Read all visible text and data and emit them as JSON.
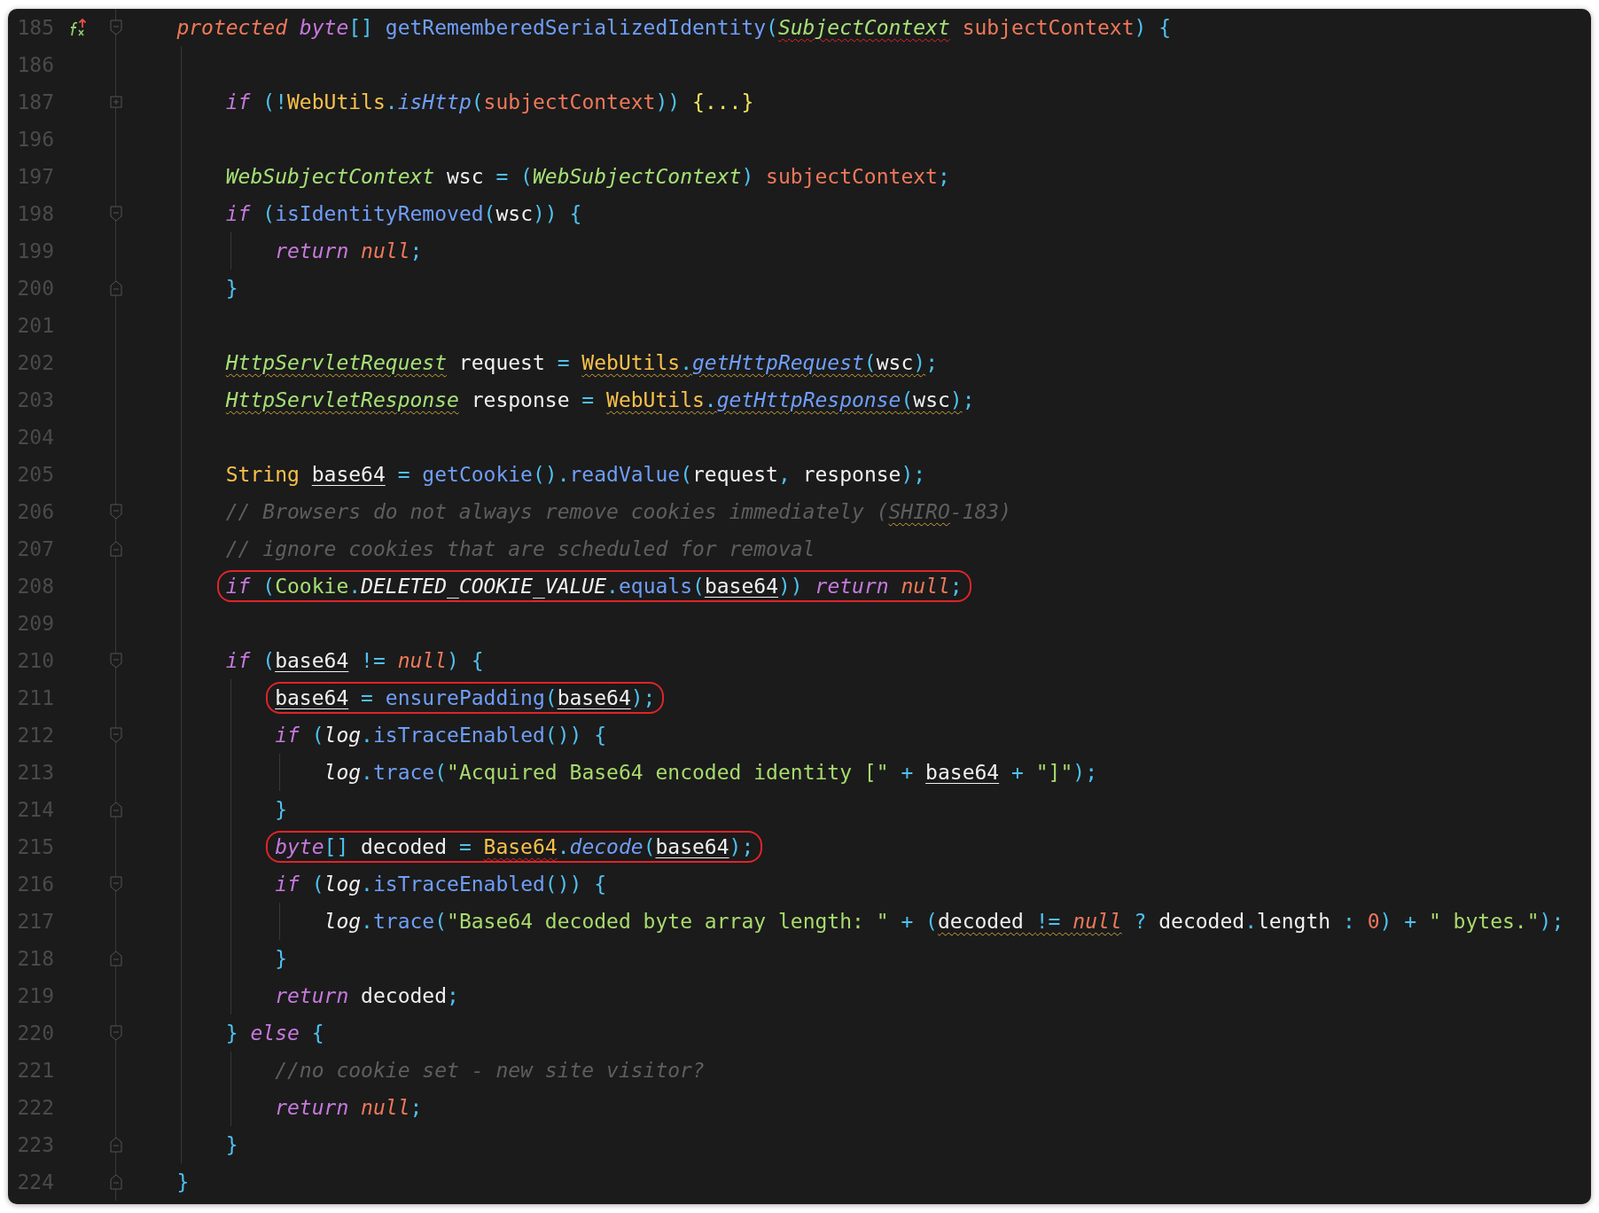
{
  "lines": [
    {
      "number": "185",
      "fold": {
        "kind": "start"
      },
      "marker": {
        "kind": "recursion"
      },
      "tokens": [
        {
          "text": "protected ",
          "kind": "modifier"
        },
        {
          "text": "byte",
          "kind": "keyword"
        },
        {
          "text": "[] ",
          "kind": "punct"
        },
        {
          "text": "getRememberedSerializedIdentity",
          "kind": "method"
        },
        {
          "text": "(",
          "kind": "punct"
        },
        {
          "text": "SubjectContext",
          "kind": "type",
          "deco": {
            "kind": "error"
          }
        },
        {
          "text": " subjectContext",
          "kind": "param"
        },
        {
          "text": ") {",
          "kind": "punct"
        }
      ],
      "children": [
        {
          "number": "186"
        },
        {
          "number": "187",
          "fold": {
            "kind": "collapsed"
          },
          "tokens": [
            {
              "text": "if ",
              "kind": "keyword"
            },
            {
              "text": "(!",
              "kind": "punct"
            },
            {
              "text": "WebUtils",
              "kind": "class"
            },
            {
              "text": ".",
              "kind": "punct"
            },
            {
              "text": "isHttp",
              "kind": "static-method"
            },
            {
              "text": "(",
              "kind": "punct"
            },
            {
              "text": "subjectContext",
              "kind": "param"
            },
            {
              "text": ")) ",
              "kind": "punct"
            },
            {
              "text": "{...}",
              "kind": "folded"
            }
          ]
        },
        {
          "number": "196"
        },
        {
          "number": "197",
          "tokens": [
            {
              "text": "WebSubjectContext",
              "kind": "type"
            },
            {
              "text": " wsc ",
              "kind": "plain"
            },
            {
              "text": "= (",
              "kind": "punct"
            },
            {
              "text": "WebSubjectContext",
              "kind": "type"
            },
            {
              "text": ") ",
              "kind": "punct"
            },
            {
              "text": "subjectContext",
              "kind": "param"
            },
            {
              "text": ";",
              "kind": "punct"
            }
          ]
        },
        {
          "number": "198",
          "fold": {
            "kind": "start"
          },
          "tokens": [
            {
              "text": "if ",
              "kind": "keyword"
            },
            {
              "text": "(",
              "kind": "punct"
            },
            {
              "text": "isIdentityRemoved",
              "kind": "method"
            },
            {
              "text": "(",
              "kind": "punct"
            },
            {
              "text": "wsc",
              "kind": "plain"
            },
            {
              "text": ")) {",
              "kind": "punct"
            }
          ],
          "children": [
            {
              "number": "199",
              "tokens": [
                {
                  "text": "return ",
                  "kind": "keyword"
                },
                {
                  "text": "null",
                  "kind": "null"
                },
                {
                  "text": ";",
                  "kind": "punct"
                }
              ]
            }
          ]
        },
        {
          "number": "200",
          "fold": {
            "kind": "end"
          },
          "tokens": [
            {
              "text": "}",
              "kind": "punct"
            }
          ]
        },
        {
          "number": "201"
        },
        {
          "number": "202",
          "tokens": [
            {
              "text": "HttpServletRequest",
              "kind": "type",
              "deco": {
                "kind": "warning"
              }
            },
            {
              "text": " request ",
              "kind": "plain"
            },
            {
              "text": "= ",
              "kind": "punct"
            },
            {
              "text": "WebUtils",
              "kind": "class",
              "deco": {
                "kind": "warning"
              }
            },
            {
              "text": ".",
              "kind": "punct",
              "deco": {
                "kind": "warning"
              }
            },
            {
              "text": "getHttpRequest",
              "kind": "static-method",
              "deco": {
                "kind": "warning"
              }
            },
            {
              "text": "(",
              "kind": "punct",
              "deco": {
                "kind": "warning"
              }
            },
            {
              "text": "wsc",
              "kind": "plain",
              "deco": {
                "kind": "warning"
              }
            },
            {
              "text": ")",
              "kind": "punct",
              "deco": {
                "kind": "warning"
              }
            },
            {
              "text": ";",
              "kind": "punct"
            }
          ]
        },
        {
          "number": "203",
          "tokens": [
            {
              "text": "HttpServletResponse",
              "kind": "type",
              "deco": {
                "kind": "warning"
              }
            },
            {
              "text": " response ",
              "kind": "plain"
            },
            {
              "text": "= ",
              "kind": "punct"
            },
            {
              "text": "WebUtils",
              "kind": "class",
              "deco": {
                "kind": "warning"
              }
            },
            {
              "text": ".",
              "kind": "punct",
              "deco": {
                "kind": "warning"
              }
            },
            {
              "text": "getHttpResponse",
              "kind": "static-method",
              "deco": {
                "kind": "warning"
              }
            },
            {
              "text": "(",
              "kind": "punct",
              "deco": {
                "kind": "warning"
              }
            },
            {
              "text": "wsc",
              "kind": "plain",
              "deco": {
                "kind": "warning"
              }
            },
            {
              "text": ")",
              "kind": "punct",
              "deco": {
                "kind": "warning"
              }
            },
            {
              "text": ";",
              "kind": "punct"
            }
          ]
        },
        {
          "number": "204"
        },
        {
          "number": "205",
          "tokens": [
            {
              "text": "String ",
              "kind": "class"
            },
            {
              "text": "base64",
              "kind": "plain",
              "deco": {
                "kind": "underline"
              }
            },
            {
              "text": " = ",
              "kind": "punct"
            },
            {
              "text": "getCookie",
              "kind": "method"
            },
            {
              "text": "().",
              "kind": "punct"
            },
            {
              "text": "readValue",
              "kind": "method"
            },
            {
              "text": "(",
              "kind": "punct"
            },
            {
              "text": "request",
              "kind": "plain"
            },
            {
              "text": ", ",
              "kind": "punct"
            },
            {
              "text": "response",
              "kind": "plain"
            },
            {
              "text": ");",
              "kind": "punct"
            }
          ]
        },
        {
          "number": "206",
          "fold": {
            "kind": "start"
          },
          "tokens": [
            {
              "text": "// Browsers do not always remove cookies immediately (",
              "kind": "comment"
            },
            {
              "text": "SHIRO",
              "kind": "comment",
              "deco": {
                "kind": "warning"
              }
            },
            {
              "text": "-183)",
              "kind": "comment"
            }
          ]
        },
        {
          "number": "207",
          "fold": {
            "kind": "end"
          },
          "tokens": [
            {
              "text": "// ignore cookies that are scheduled for removal",
              "kind": "comment"
            }
          ]
        },
        {
          "number": "208",
          "circled": true,
          "tokens": [
            {
              "text": "if ",
              "kind": "keyword"
            },
            {
              "text": "(",
              "kind": "punct"
            },
            {
              "text": "Cookie",
              "kind": "type-plain"
            },
            {
              "text": ".",
              "kind": "punct"
            },
            {
              "text": "DELETED_COOKIE_VALUE",
              "kind": "field"
            },
            {
              "text": ".",
              "kind": "punct"
            },
            {
              "text": "equals",
              "kind": "method"
            },
            {
              "text": "(",
              "kind": "punct"
            },
            {
              "text": "base64",
              "kind": "plain",
              "deco": {
                "kind": "underline"
              }
            },
            {
              "text": ")) ",
              "kind": "punct"
            },
            {
              "text": "return ",
              "kind": "keyword"
            },
            {
              "text": "null",
              "kind": "null"
            },
            {
              "text": ";",
              "kind": "punct"
            }
          ]
        },
        {
          "number": "209"
        },
        {
          "number": "210",
          "fold": {
            "kind": "start"
          },
          "tokens": [
            {
              "text": "if ",
              "kind": "keyword"
            },
            {
              "text": "(",
              "kind": "punct"
            },
            {
              "text": "base64",
              "kind": "plain",
              "deco": {
                "kind": "underline"
              }
            },
            {
              "text": " != ",
              "kind": "punct"
            },
            {
              "text": "null",
              "kind": "null"
            },
            {
              "text": ") {",
              "kind": "punct"
            }
          ],
          "children": [
            {
              "number": "211",
              "circled": true,
              "tokens": [
                {
                  "text": "base64",
                  "kind": "plain",
                  "deco": {
                    "kind": "underline"
                  }
                },
                {
                  "text": " = ",
                  "kind": "punct"
                },
                {
                  "text": "ensurePadding",
                  "kind": "method"
                },
                {
                  "text": "(",
                  "kind": "punct"
                },
                {
                  "text": "base64",
                  "kind": "plain",
                  "deco": {
                    "kind": "underline"
                  }
                },
                {
                  "text": ");",
                  "kind": "punct"
                }
              ]
            },
            {
              "number": "212",
              "fold": {
                "kind": "start"
              },
              "tokens": [
                {
                  "text": "if ",
                  "kind": "keyword"
                },
                {
                  "text": "(",
                  "kind": "punct"
                },
                {
                  "text": "log",
                  "kind": "field"
                },
                {
                  "text": ".",
                  "kind": "punct"
                },
                {
                  "text": "isTraceEnabled",
                  "kind": "method"
                },
                {
                  "text": "()) {",
                  "kind": "punct"
                }
              ],
              "children": [
                {
                  "number": "213",
                  "tokens": [
                    {
                      "text": "log",
                      "kind": "field"
                    },
                    {
                      "text": ".",
                      "kind": "punct"
                    },
                    {
                      "text": "trace",
                      "kind": "method"
                    },
                    {
                      "text": "(",
                      "kind": "punct"
                    },
                    {
                      "text": "\"Acquired Base64 encoded identity [\"",
                      "kind": "string"
                    },
                    {
                      "text": " + ",
                      "kind": "punct"
                    },
                    {
                      "text": "base64",
                      "kind": "plain",
                      "deco": {
                        "kind": "underline"
                      }
                    },
                    {
                      "text": " + ",
                      "kind": "punct"
                    },
                    {
                      "text": "\"]\"",
                      "kind": "string"
                    },
                    {
                      "text": ");",
                      "kind": "punct"
                    }
                  ]
                }
              ]
            },
            {
              "number": "214",
              "fold": {
                "kind": "end"
              },
              "tokens": [
                {
                  "text": "}",
                  "kind": "punct"
                }
              ]
            },
            {
              "number": "215",
              "circled": true,
              "tokens": [
                {
                  "text": "byte",
                  "kind": "keyword"
                },
                {
                  "text": "[] ",
                  "kind": "punct"
                },
                {
                  "text": "decoded ",
                  "kind": "plain"
                },
                {
                  "text": "= ",
                  "kind": "punct"
                },
                {
                  "text": "Base64",
                  "kind": "class",
                  "deco": {
                    "kind": "error"
                  }
                },
                {
                  "text": ".",
                  "kind": "punct"
                },
                {
                  "text": "decode",
                  "kind": "static-method"
                },
                {
                  "text": "(",
                  "kind": "punct"
                },
                {
                  "text": "base64",
                  "kind": "plain",
                  "deco": {
                    "kind": "underline"
                  }
                },
                {
                  "text": ");",
                  "kind": "punct"
                }
              ]
            },
            {
              "number": "216",
              "fold": {
                "kind": "start"
              },
              "tokens": [
                {
                  "text": "if ",
                  "kind": "keyword"
                },
                {
                  "text": "(",
                  "kind": "punct"
                },
                {
                  "text": "log",
                  "kind": "field"
                },
                {
                  "text": ".",
                  "kind": "punct"
                },
                {
                  "text": "isTraceEnabled",
                  "kind": "method"
                },
                {
                  "text": "()) {",
                  "kind": "punct"
                }
              ],
              "children": [
                {
                  "number": "217",
                  "tokens": [
                    {
                      "text": "log",
                      "kind": "field"
                    },
                    {
                      "text": ".",
                      "kind": "punct"
                    },
                    {
                      "text": "trace",
                      "kind": "method"
                    },
                    {
                      "text": "(",
                      "kind": "punct"
                    },
                    {
                      "text": "\"Base64 decoded byte array length: \"",
                      "kind": "string"
                    },
                    {
                      "text": " + (",
                      "kind": "punct"
                    },
                    {
                      "text": "decoded ",
                      "kind": "plain",
                      "deco": {
                        "kind": "warning"
                      }
                    },
                    {
                      "text": "!= ",
                      "kind": "punct",
                      "deco": {
                        "kind": "warning"
                      }
                    },
                    {
                      "text": "null",
                      "kind": "null",
                      "deco": {
                        "kind": "warning"
                      }
                    },
                    {
                      "text": " ? ",
                      "kind": "punct"
                    },
                    {
                      "text": "decoded",
                      "kind": "plain"
                    },
                    {
                      "text": ".",
                      "kind": "punct"
                    },
                    {
                      "text": "length ",
                      "kind": "plain"
                    },
                    {
                      "text": ": ",
                      "kind": "punct"
                    },
                    {
                      "text": "0",
                      "kind": "number"
                    },
                    {
                      "text": ") + ",
                      "kind": "punct"
                    },
                    {
                      "text": "\" bytes.\"",
                      "kind": "string"
                    },
                    {
                      "text": ");",
                      "kind": "punct"
                    }
                  ]
                }
              ]
            },
            {
              "number": "218",
              "fold": {
                "kind": "end"
              },
              "tokens": [
                {
                  "text": "}",
                  "kind": "punct"
                }
              ]
            },
            {
              "number": "219",
              "tokens": [
                {
                  "text": "return ",
                  "kind": "keyword"
                },
                {
                  "text": "decoded",
                  "kind": "plain"
                },
                {
                  "text": ";",
                  "kind": "punct"
                }
              ]
            }
          ]
        },
        {
          "number": "220",
          "fold": {
            "kind": "start"
          },
          "tokens": [
            {
              "text": "} ",
              "kind": "punct"
            },
            {
              "text": "else ",
              "kind": "keyword"
            },
            {
              "text": "{",
              "kind": "punct"
            }
          ],
          "children": [
            {
              "number": "221",
              "tokens": [
                {
                  "text": "//no cookie set - new site visitor?",
                  "kind": "comment"
                }
              ]
            },
            {
              "number": "222",
              "tokens": [
                {
                  "text": "return ",
                  "kind": "keyword"
                },
                {
                  "text": "null",
                  "kind": "null"
                },
                {
                  "text": ";",
                  "kind": "punct"
                }
              ]
            }
          ]
        },
        {
          "number": "223",
          "fold": {
            "kind": "end"
          },
          "tokens": [
            {
              "text": "}",
              "kind": "punct"
            }
          ]
        }
      ]
    },
    {
      "number": "224",
      "fold": {
        "kind": "end"
      },
      "tokens": [
        {
          "text": "}",
          "kind": "punct"
        }
      ]
    }
  ]
}
